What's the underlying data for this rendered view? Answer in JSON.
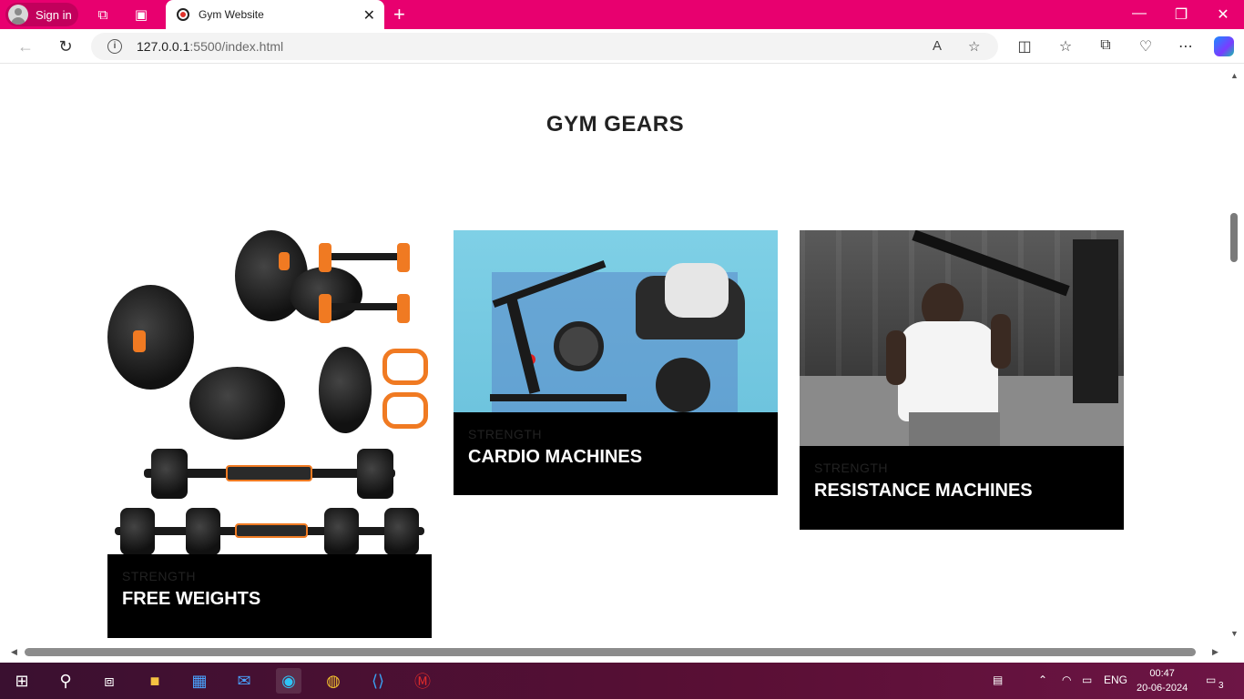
{
  "browser": {
    "signin_label": "Sign in",
    "tab_title": "Gym Website",
    "url_host": "127.0.0.1",
    "url_path": ":5500/index.html",
    "accent_color": "#e8006f"
  },
  "page": {
    "section_title": "GYM GEARS",
    "cards": [
      {
        "tag": "STRENGTH",
        "name": "FREE WEIGHTS"
      },
      {
        "tag": "STRENGTH",
        "name": "CARDIO MACHINES"
      },
      {
        "tag": "STRENGTH",
        "name": "RESISTANCE MACHINES"
      }
    ]
  },
  "taskbar": {
    "lang": "ENG",
    "time": "00:47",
    "date": "20-06-2024",
    "notifications": "3"
  }
}
